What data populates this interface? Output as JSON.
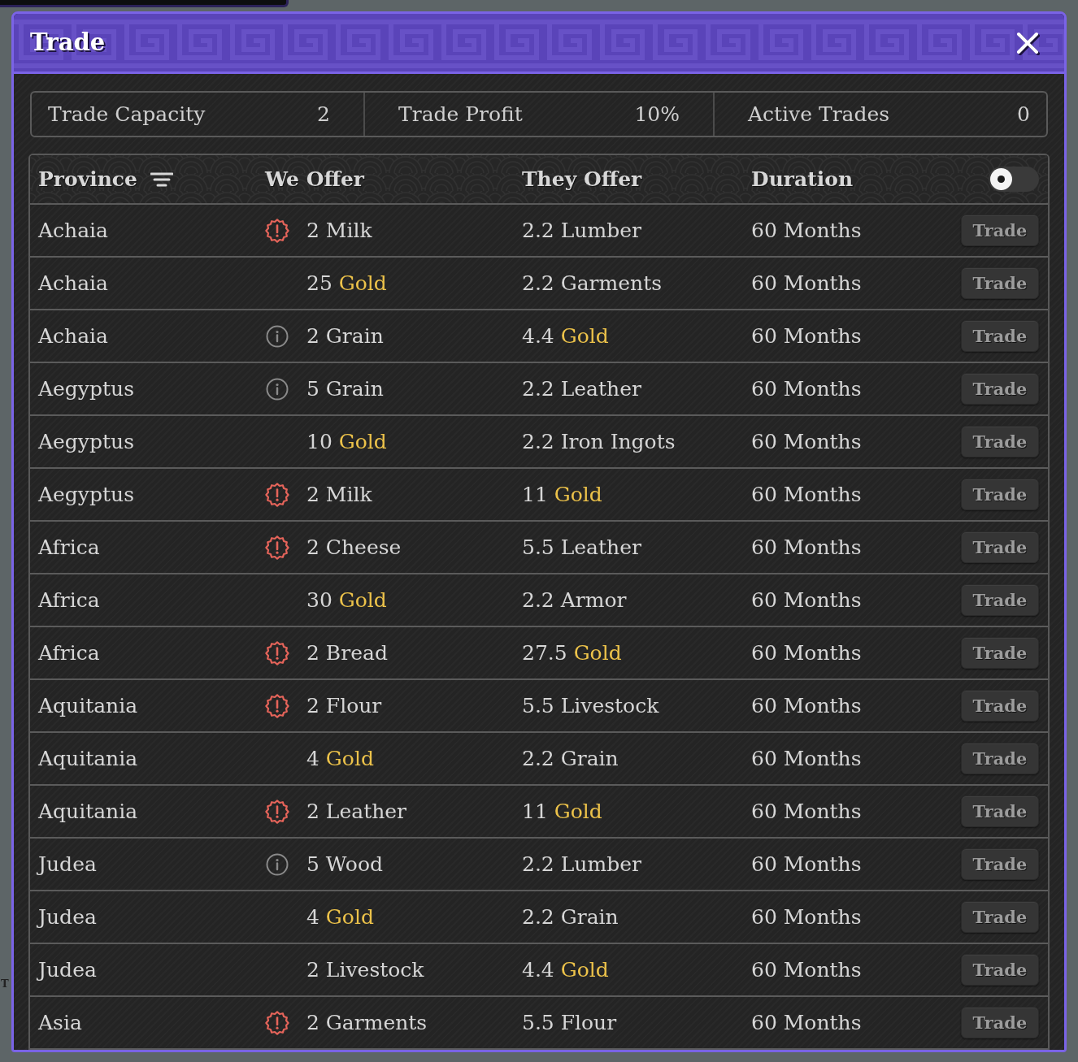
{
  "window": {
    "title": "Trade"
  },
  "stats": [
    {
      "label": "Trade Capacity",
      "value": "2"
    },
    {
      "label": "Trade Profit",
      "value": "10%"
    },
    {
      "label": "Active Trades",
      "value": "0"
    }
  ],
  "table": {
    "columns": [
      {
        "label": "Province",
        "filterable": true
      },
      {
        "label": "We Offer",
        "filterable": false
      },
      {
        "label": "They Offer",
        "filterable": false
      },
      {
        "label": "Duration",
        "filterable": false
      }
    ],
    "toggle": {
      "on": false
    },
    "rows": [
      {
        "kind": "warning",
        "province": "Achaia",
        "we_offer": {
          "amount": "2",
          "good": "Milk",
          "highlighted": false
        },
        "they_offer": {
          "amount": "2.2",
          "good": "Lumber",
          "highlighted": false
        },
        "duration": "60 Months",
        "button": "Trade"
      },
      {
        "kind": "plain",
        "province": "Achaia",
        "we_offer": {
          "amount": "25",
          "good": "Gold",
          "highlighted": true
        },
        "they_offer": {
          "amount": "2.2",
          "good": "Garments",
          "highlighted": false
        },
        "duration": "60 Months",
        "button": "Trade"
      },
      {
        "kind": "info",
        "province": "Achaia",
        "we_offer": {
          "amount": "2",
          "good": "Grain",
          "highlighted": false
        },
        "they_offer": {
          "amount": "4.4",
          "good": "Gold",
          "highlighted": true
        },
        "duration": "60 Months",
        "button": "Trade"
      },
      {
        "kind": "info",
        "province": "Aegyptus",
        "we_offer": {
          "amount": "5",
          "good": "Grain",
          "highlighted": false
        },
        "they_offer": {
          "amount": "2.2",
          "good": "Leather",
          "highlighted": false
        },
        "duration": "60 Months",
        "button": "Trade"
      },
      {
        "kind": "plain",
        "province": "Aegyptus",
        "we_offer": {
          "amount": "10",
          "good": "Gold",
          "highlighted": true
        },
        "they_offer": {
          "amount": "2.2",
          "good": "Iron Ingots",
          "highlighted": false
        },
        "duration": "60 Months",
        "button": "Trade"
      },
      {
        "kind": "warning",
        "province": "Aegyptus",
        "we_offer": {
          "amount": "2",
          "good": "Milk",
          "highlighted": false
        },
        "they_offer": {
          "amount": "11",
          "good": "Gold",
          "highlighted": true
        },
        "duration": "60 Months",
        "button": "Trade"
      },
      {
        "kind": "warning",
        "province": "Africa",
        "we_offer": {
          "amount": "2",
          "good": "Cheese",
          "highlighted": false
        },
        "they_offer": {
          "amount": "5.5",
          "good": "Leather",
          "highlighted": false
        },
        "duration": "60 Months",
        "button": "Trade"
      },
      {
        "kind": "plain",
        "province": "Africa",
        "we_offer": {
          "amount": "30",
          "good": "Gold",
          "highlighted": true
        },
        "they_offer": {
          "amount": "2.2",
          "good": "Armor",
          "highlighted": false
        },
        "duration": "60 Months",
        "button": "Trade"
      },
      {
        "kind": "warning",
        "province": "Africa",
        "we_offer": {
          "amount": "2",
          "good": "Bread",
          "highlighted": false
        },
        "they_offer": {
          "amount": "27.5",
          "good": "Gold",
          "highlighted": true
        },
        "duration": "60 Months",
        "button": "Trade"
      },
      {
        "kind": "warning",
        "province": "Aquitania",
        "we_offer": {
          "amount": "2",
          "good": "Flour",
          "highlighted": false
        },
        "they_offer": {
          "amount": "5.5",
          "good": "Livestock",
          "highlighted": false
        },
        "duration": "60 Months",
        "button": "Trade"
      },
      {
        "kind": "plain",
        "province": "Aquitania",
        "we_offer": {
          "amount": "4",
          "good": "Gold",
          "highlighted": true
        },
        "they_offer": {
          "amount": "2.2",
          "good": "Grain",
          "highlighted": false
        },
        "duration": "60 Months",
        "button": "Trade"
      },
      {
        "kind": "warning",
        "province": "Aquitania",
        "we_offer": {
          "amount": "2",
          "good": "Leather",
          "highlighted": false
        },
        "they_offer": {
          "amount": "11",
          "good": "Gold",
          "highlighted": true
        },
        "duration": "60 Months",
        "button": "Trade"
      },
      {
        "kind": "info",
        "province": "Judea",
        "we_offer": {
          "amount": "5",
          "good": "Wood",
          "highlighted": false
        },
        "they_offer": {
          "amount": "2.2",
          "good": "Lumber",
          "highlighted": false
        },
        "duration": "60 Months",
        "button": "Trade"
      },
      {
        "kind": "plain",
        "province": "Judea",
        "we_offer": {
          "amount": "4",
          "good": "Gold",
          "highlighted": true
        },
        "they_offer": {
          "amount": "2.2",
          "good": "Grain",
          "highlighted": false
        },
        "duration": "60 Months",
        "button": "Trade"
      },
      {
        "kind": "plain",
        "province": "Judea",
        "we_offer": {
          "amount": "2",
          "good": "Livestock",
          "highlighted": false
        },
        "they_offer": {
          "amount": "4.4",
          "good": "Gold",
          "highlighted": true
        },
        "duration": "60 Months",
        "button": "Trade"
      },
      {
        "kind": "warning",
        "province": "Asia",
        "we_offer": {
          "amount": "2",
          "good": "Garments",
          "highlighted": false
        },
        "they_offer": {
          "amount": "5.5",
          "good": "Flour",
          "highlighted": false
        },
        "duration": "60 Months",
        "button": "Trade"
      }
    ]
  },
  "map_label": "T"
}
